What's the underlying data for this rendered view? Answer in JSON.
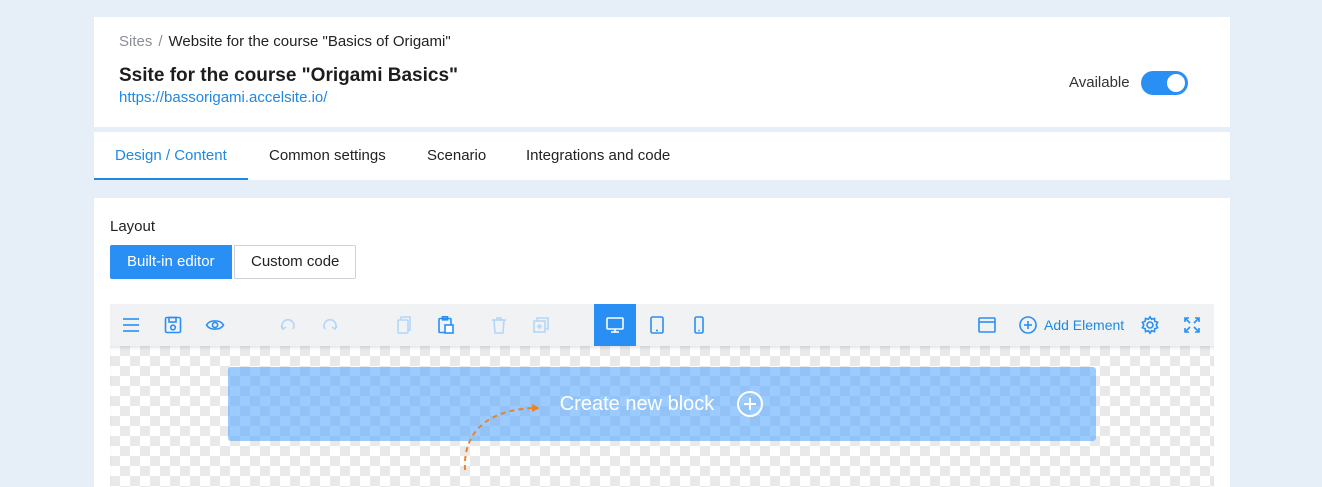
{
  "header": {
    "breadcrumb_root": "Sites",
    "breadcrumb_separator": "/",
    "breadcrumb_current": "Website for the course \"Basics of Origami\"",
    "title": "Ssite for the course \"Origami Basics\"",
    "url": "https://bassorigami.accelsite.io/",
    "availability_label": "Available",
    "available": true
  },
  "tabs": [
    {
      "label": "Design / Content",
      "active": true
    },
    {
      "label": "Common settings",
      "active": false
    },
    {
      "label": "Scenario",
      "active": false
    },
    {
      "label": "Integrations and code",
      "active": false
    }
  ],
  "layout": {
    "label": "Layout",
    "options": [
      {
        "label": "Built-in editor",
        "active": true
      },
      {
        "label": "Custom code",
        "active": false
      }
    ]
  },
  "toolbar": {
    "icons": [
      "menu-icon",
      "save-icon",
      "preview-eye-icon",
      "undo-icon",
      "redo-icon",
      "copy-icon",
      "paste-icon",
      "delete-icon",
      "duplicate-icon",
      "desktop-icon",
      "tablet-icon",
      "mobile-icon",
      "window-icon",
      "add-circle-icon",
      "gear-icon",
      "fullscreen-icon"
    ],
    "active_device": "desktop",
    "add_element_label": "Add Element"
  },
  "canvas": {
    "create_block_label": "Create new block"
  },
  "colors": {
    "accent": "#1e88e5",
    "toggle_on": "#2a8ff4",
    "page_bg": "#e6eef8",
    "create_block_bg": "#8cc4fb",
    "hint_arrow": "#e8832a"
  }
}
